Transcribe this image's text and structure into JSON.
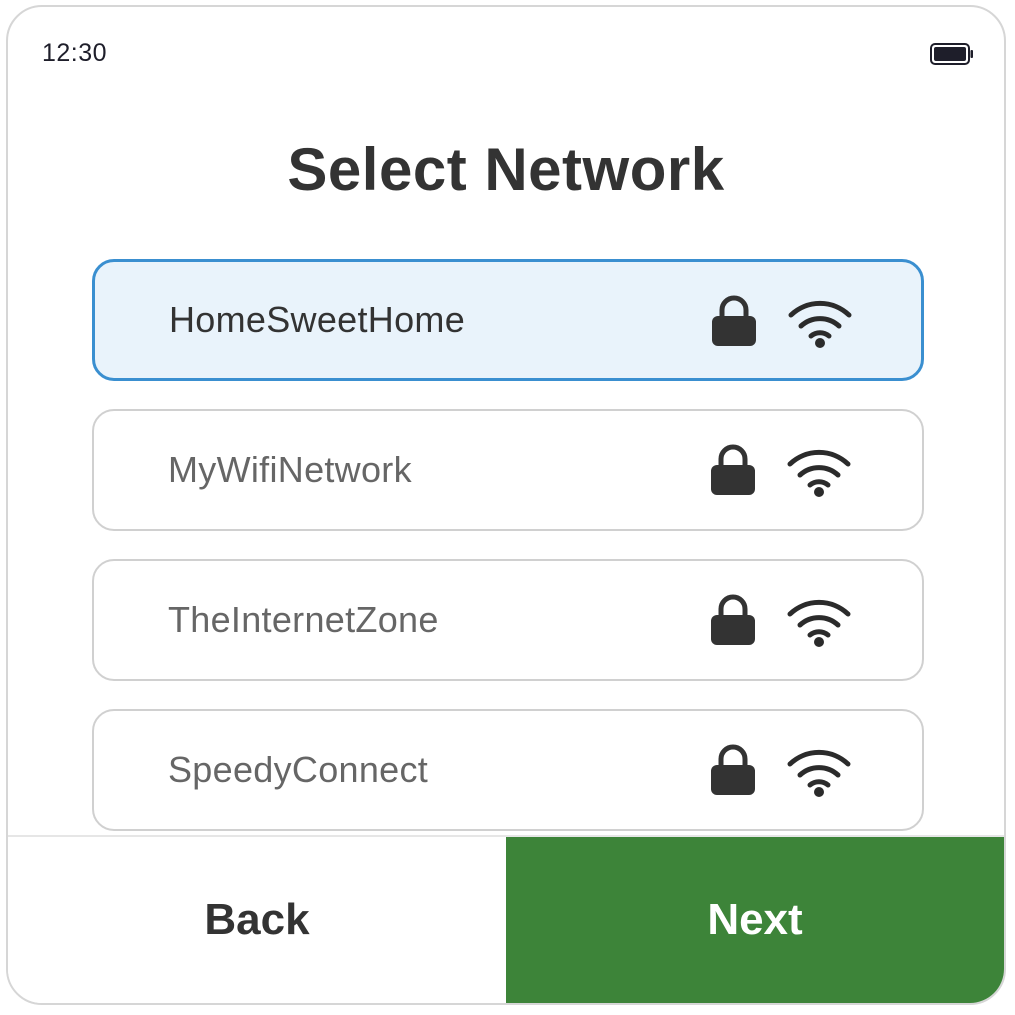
{
  "status_bar": {
    "time": "12:30",
    "battery_icon": "battery-full-icon"
  },
  "page": {
    "title": "Select Network"
  },
  "networks": [
    {
      "name": "HomeSweetHome",
      "secured": true,
      "selected": true,
      "lock_icon": "lock-icon",
      "signal_icon": "wifi-icon"
    },
    {
      "name": "MyWifiNetwork",
      "secured": true,
      "selected": false,
      "lock_icon": "lock-icon",
      "signal_icon": "wifi-icon"
    },
    {
      "name": "TheInternetZone",
      "secured": true,
      "selected": false,
      "lock_icon": "lock-icon",
      "signal_icon": "wifi-icon"
    },
    {
      "name": "SpeedyConnect",
      "secured": true,
      "selected": false,
      "lock_icon": "lock-icon",
      "signal_icon": "wifi-icon"
    }
  ],
  "footer": {
    "back_label": "Back",
    "next_label": "Next"
  },
  "colors": {
    "selected_border": "#3a8fd0",
    "selected_background": "#e9f3fb",
    "next_button": "#3d8439",
    "text_dark": "#333333",
    "text_muted": "#666666"
  }
}
